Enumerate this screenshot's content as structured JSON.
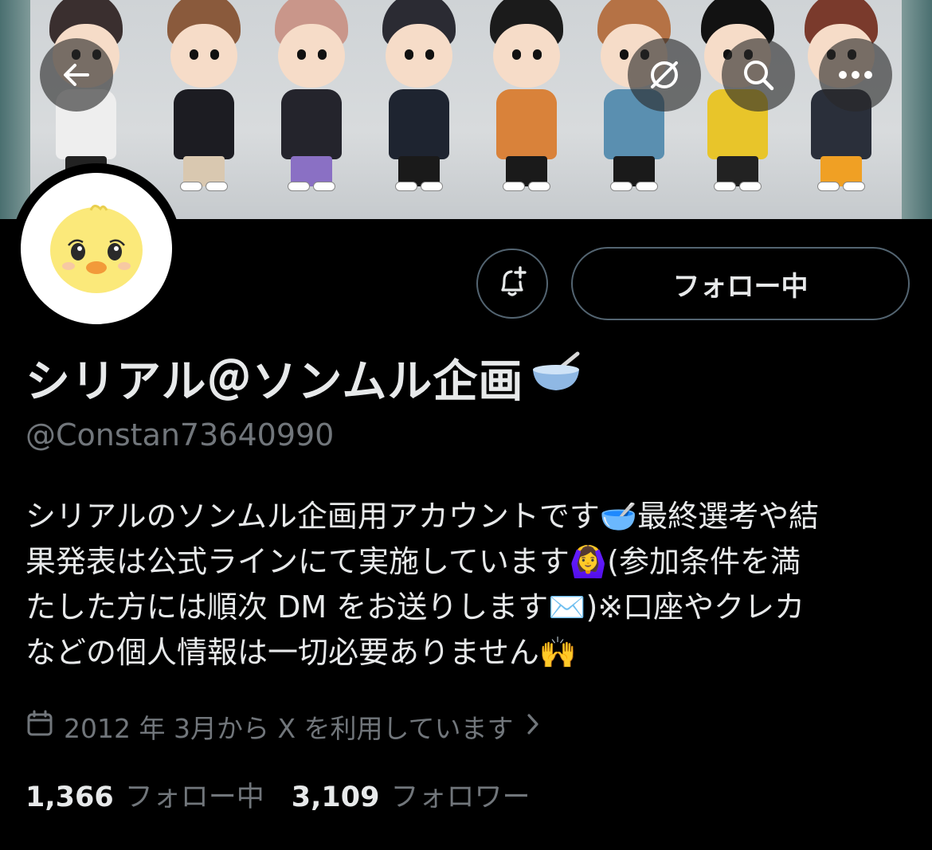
{
  "profile": {
    "display_name": "シリアル＠ソンムル企画",
    "handle": "@Constan73640990",
    "bio_lines": [
      "シリアルのソンムル企画用アカウントです🥣最終選考や結",
      "果発表は公式ラインにて実施しています🙆‍♀️(参加条件を満",
      "たした方には順次 DM をお送りします✉️)※口座やクレカ",
      "などの個人情報は一切必要ありません🙌"
    ],
    "joined": "2012 年 3月から X を利用しています"
  },
  "buttons": {
    "follow_label": "フォロー中"
  },
  "stats": {
    "following_count": "1,366",
    "following_label": "フォロー中",
    "followers_count": "3,109",
    "followers_label": "フォロワー"
  },
  "icons": {
    "back": "back-arrow-icon",
    "grok": "grok-icon",
    "search": "search-icon",
    "more": "more-icon",
    "bell": "notification-bell-plus-icon",
    "calendar": "calendar-icon",
    "chevron": "chevron-right-icon"
  },
  "colors": {
    "background": "#000000",
    "text_primary": "#e7e9ea",
    "text_secondary": "#71767b",
    "border": "#536471"
  }
}
